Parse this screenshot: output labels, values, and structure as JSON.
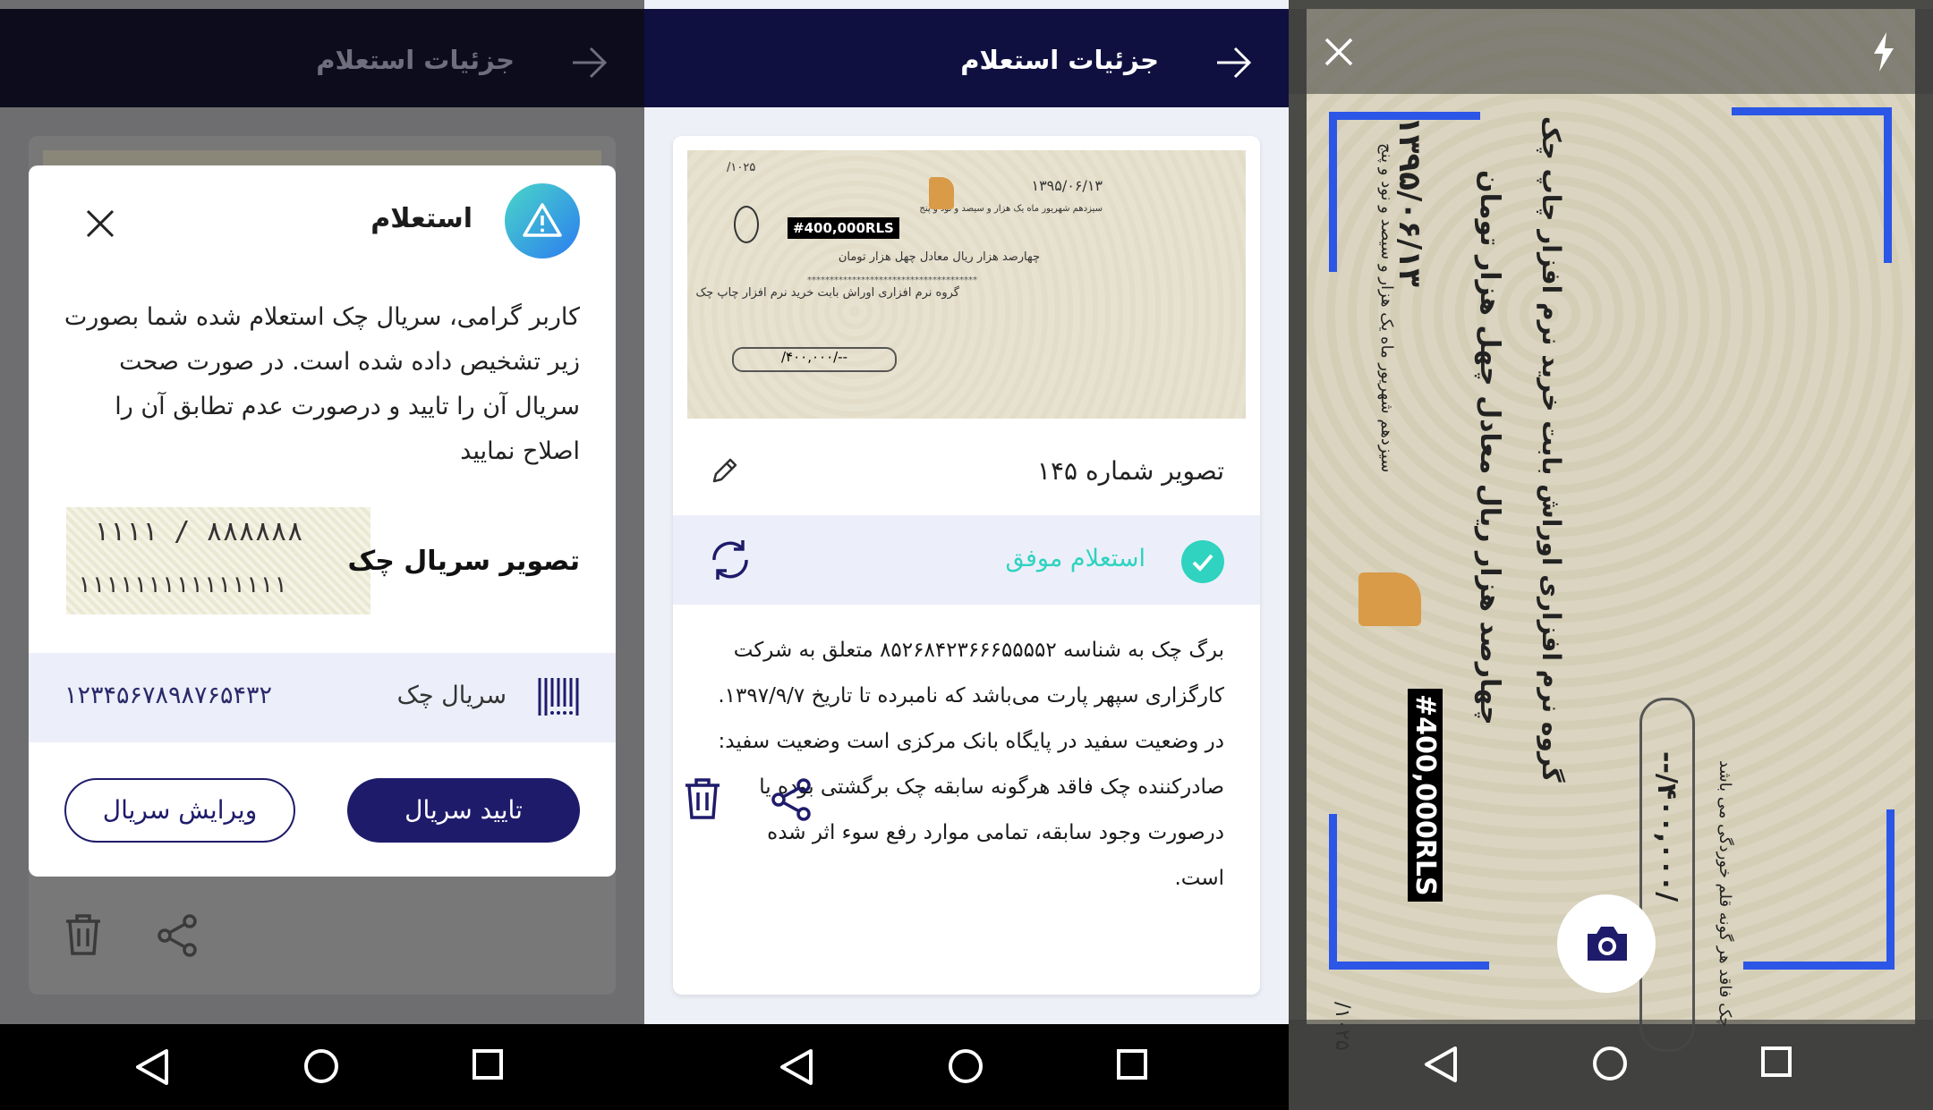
{
  "screen1": {
    "header_title": "جزئیات استعلام",
    "dialog": {
      "title": "استعلام",
      "message": "کاربر گرامی، سریال چک استعلام شده شما بصورت زیر تشخیص داده شده است. در صورت صحت سریال آن را تایید و درصورت عدم تطابق آن را اصلاح نمایید",
      "serial_image_label": "تصویر سریال چک",
      "serial_image_line1": "۱۱۱۱ / ۸۸۸۸۸۸",
      "serial_image_line2": "۱۱۱۱۱۱۱۱۱۱۱۱۱۱۱",
      "serial_label": "سریال چک",
      "serial_value": "۱۲۳۴۵۶۷۸۹۸۷۶۵۴۳۲",
      "confirm_button": "تایید سریال",
      "edit_button": "ویرایش سریال"
    }
  },
  "screen2": {
    "header_title": "جزئیات استعلام",
    "check": {
      "date": "۱۳۹۵/۰۶/۱۳",
      "date_words": "سیزدهم شهریور ماه یک هزار و سیصد و نود و پنج",
      "amount_box": "#400,000RLS",
      "amount_words": "چهارصد هزار ریال معادل چهل هزار تومان",
      "payee": "گروه نرم افزاری اوراش بابت خرید نرم افزار چاپ چک",
      "amount_digits": "/۴۰۰,۰۰۰/--",
      "serial_corner": "۱۰۲۵/"
    },
    "image_number_label": "تصویر شماره ۱۴۵",
    "status_text": "استعلام موفق",
    "description": "برگ چک به شناسه ۸۵۲۶۸۴۲۳۶۶۶۵۵۵۵۲ متعلق به شرکت کارگزاری سپهر پارت می‌باشد که نامبرده تا تاریخ ۱۳۹۷/۹/۷. در وضعیت سفید در پایگاه بانک مرکزی است وضعیت سفید: صادرکننده چک فاقد هرگونه سابقه چک برگشتی بوده یا درصورت وجود سابقه، تمامی موارد رفع سوء اثر شده است."
  },
  "screen3": {
    "check_date": "۱۳۹۵/۰۶/۱۳",
    "date_words": "سیزدهم شهریور ماه یک هزار و سیصد و نود و پنج",
    "amount_words": "چهارصد هزار ریال معادل چهل هزار تومان",
    "payee": "گروه نرم افزاری اوراش بابت خرید نرم افزار چاپ چک",
    "amount_box": "#400,000RLS",
    "amount_digits": "/۴۰۰,۰۰۰/--",
    "serial_corner": "۱۰۲۵/",
    "note": "چک فاقد هر گونه قلم خوردگی می باشد"
  },
  "colors": {
    "header": "#0f1040",
    "accent": "#1f1b6b",
    "success": "#2fd3c0",
    "frame": "#2c56e6"
  }
}
